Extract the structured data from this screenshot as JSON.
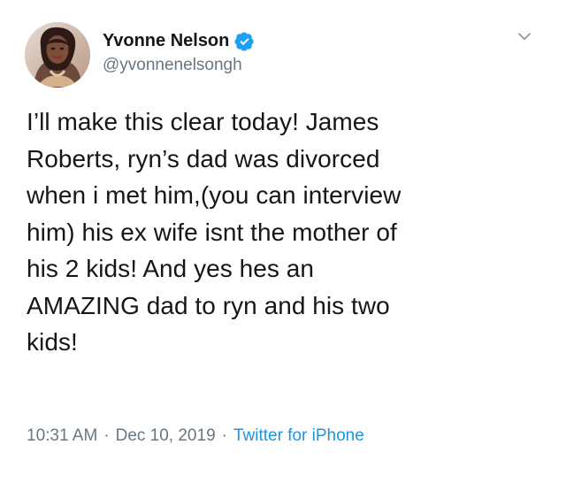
{
  "author": {
    "display_name": "Yvonne Nelson",
    "handle": "@yvonnenelsongh",
    "verified_icon": "verified-badge-icon"
  },
  "tweet": {
    "text_lines": [
      "I’ll make this clear today! James",
      "Roberts, ryn’s dad was divorced",
      "when i met him,(you can interview",
      "him) his ex wife isnt the mother of",
      "his 2 kids! And yes hes an",
      "AMAZING dad to ryn and his two",
      "kids!"
    ]
  },
  "meta": {
    "time": "10:31 AM",
    "separator": "·",
    "date": "Dec 10, 2019",
    "source": "Twitter for iPhone"
  },
  "icons": {
    "menu": "chevron-down-icon",
    "avatar": "profile-photo"
  },
  "colors": {
    "text": "#14171a",
    "secondary": "#657786",
    "accent": "#1b95e0",
    "background": "#ffffff"
  }
}
